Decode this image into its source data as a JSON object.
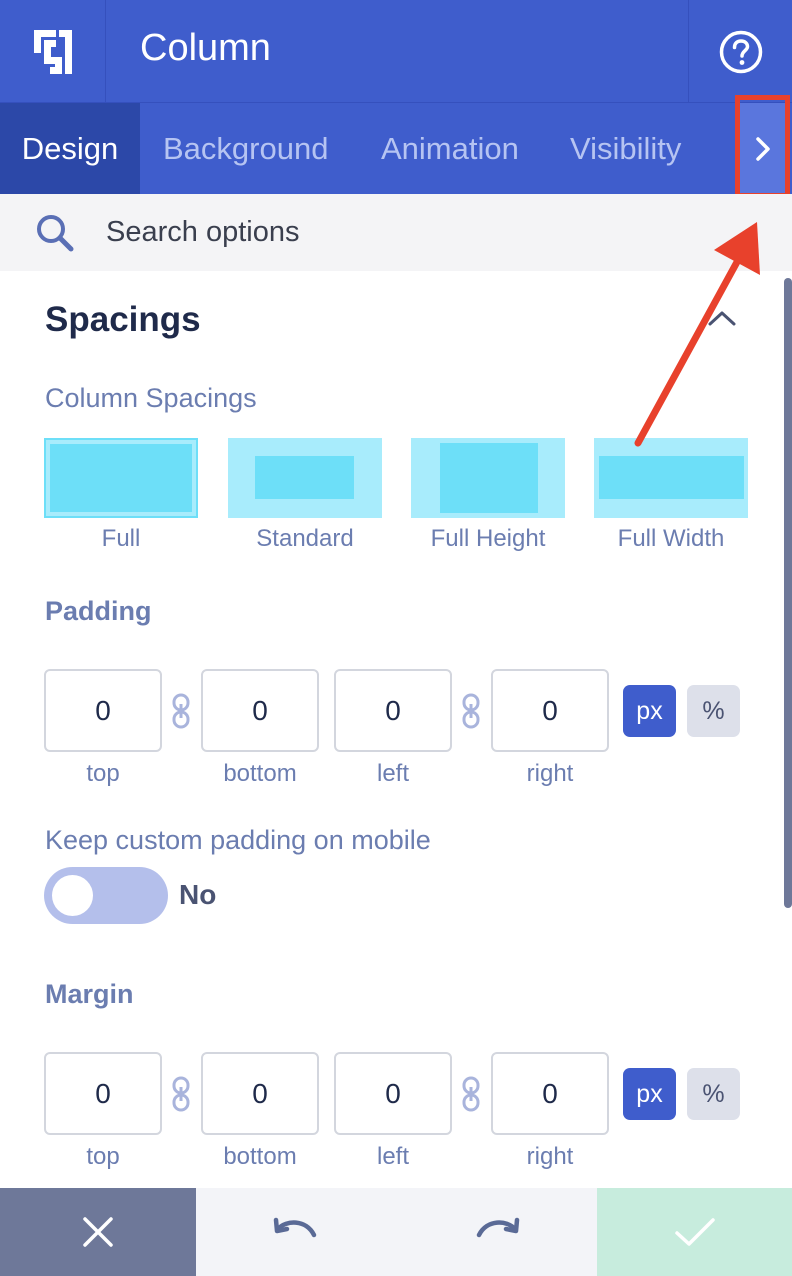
{
  "header": {
    "title": "Column",
    "logo_icon": "builder-logo-icon",
    "help_icon": "question-circle-icon"
  },
  "tabs": [
    {
      "label": "Design",
      "active": true
    },
    {
      "label": "Background",
      "active": false
    },
    {
      "label": "Animation",
      "active": false
    },
    {
      "label": "Visibility",
      "active": false
    }
  ],
  "tabs_next_icon": "chevron-right-icon",
  "search": {
    "placeholder": "Search options",
    "icon": "search-icon"
  },
  "section": {
    "title": "Spacings",
    "collapse_icon": "chevron-up-icon"
  },
  "column_spacings": {
    "label": "Column Spacings",
    "options": [
      "Full",
      "Standard",
      "Full Height",
      "Full Width"
    ],
    "selected": "Full"
  },
  "padding": {
    "label": "Padding",
    "values": {
      "top": "0",
      "bottom": "0",
      "left": "0",
      "right": "0"
    },
    "labels": {
      "top": "top",
      "bottom": "bottom",
      "left": "left",
      "right": "right"
    },
    "units": [
      "px",
      "%"
    ],
    "selected_unit": "px"
  },
  "mobile_padding": {
    "label": "Keep custom padding on mobile",
    "state_text": "No",
    "enabled": false
  },
  "margin": {
    "label": "Margin",
    "values": {
      "top": "0",
      "bottom": "0",
      "left": "0",
      "right": "0"
    },
    "labels": {
      "top": "top",
      "bottom": "bottom",
      "left": "left",
      "right": "right"
    },
    "units": [
      "px",
      "%"
    ],
    "selected_unit": "px"
  },
  "footer": {
    "close_icon": "close-icon",
    "undo_icon": "undo-icon",
    "redo_icon": "redo-icon",
    "save_icon": "checkmark-icon"
  },
  "colors": {
    "primary": "#3f5dcc",
    "tab_active": "#2c48a8",
    "annotation": "#e8412c",
    "spacing_light": "#a8ecfc",
    "spacing_dark": "#6ddff8"
  }
}
